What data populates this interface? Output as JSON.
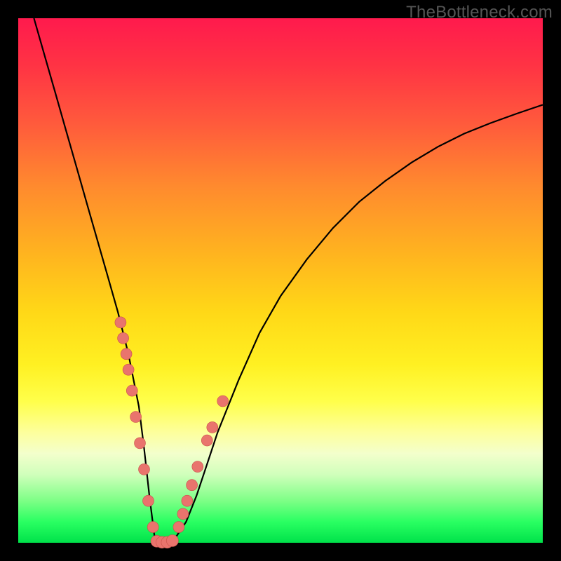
{
  "watermark": "TheBottleneck.com",
  "colors": {
    "frame": "#000000",
    "curve_stroke": "#000000",
    "marker_fill": "#e9746d",
    "marker_stroke": "#c9504a"
  },
  "chart_data": {
    "type": "line",
    "title": "",
    "xlabel": "",
    "ylabel": "",
    "xlim": [
      0,
      100
    ],
    "ylim": [
      0,
      100
    ],
    "grid": false,
    "legend": null,
    "series": [
      {
        "name": "curve",
        "x": [
          3,
          5,
          7,
          9,
          11,
          13,
          15,
          17,
          19,
          21,
          23,
          24,
          25,
          26,
          27,
          28,
          30,
          32,
          34,
          36,
          38,
          42,
          46,
          50,
          55,
          60,
          65,
          70,
          75,
          80,
          85,
          90,
          95,
          100
        ],
        "y": [
          100,
          93,
          86,
          79,
          72,
          65,
          58,
          51,
          44,
          36,
          26,
          18,
          9,
          1,
          0,
          0,
          1,
          4,
          9,
          15,
          21,
          31,
          40,
          47,
          54,
          60,
          65,
          69,
          72.5,
          75.5,
          78,
          80,
          81.8,
          83.5
        ]
      },
      {
        "name": "markers-left",
        "x": [
          19.5,
          20.0,
          20.6,
          21.0,
          21.7,
          22.4,
          23.2,
          24.0,
          24.8,
          25.7
        ],
        "y": [
          42,
          39,
          36,
          33,
          29,
          24,
          19,
          14,
          8,
          3
        ]
      },
      {
        "name": "markers-bottom",
        "x": [
          26.4,
          27.4,
          28.4,
          29.4
        ],
        "y": [
          0.3,
          0.1,
          0.1,
          0.4
        ]
      },
      {
        "name": "markers-right",
        "x": [
          30.6,
          31.4,
          32.2,
          33.1,
          34.2,
          36.0,
          37.0,
          39.0
        ],
        "y": [
          3,
          5.5,
          8,
          11,
          14.5,
          19.5,
          22,
          27
        ]
      }
    ]
  }
}
